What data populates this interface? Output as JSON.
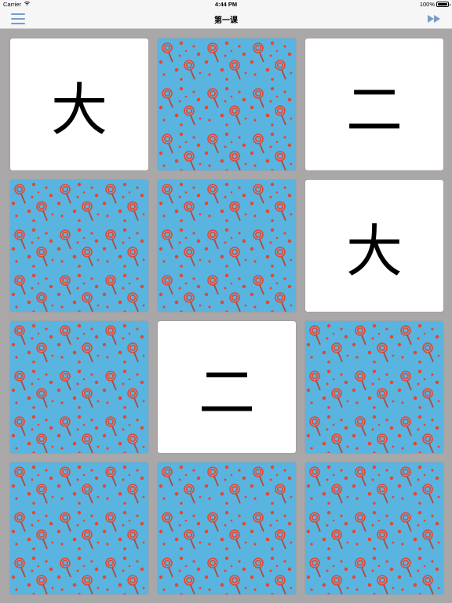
{
  "status_bar": {
    "carrier": "Carrier",
    "time": "4:44 PM",
    "battery_percent": "100%",
    "battery_level": 1.0
  },
  "nav": {
    "title": "第一课",
    "menu_icon": "hamburger-menu-icon",
    "forward_icon": "fast-forward-icon",
    "accent_color": "#7a9cc6"
  },
  "card_back": {
    "pattern": "lollipop-pattern",
    "background_color": "#5ab4e0",
    "dot_color": "#e8452d",
    "lollipop_color": "#e8452d",
    "stick_color": "#b04a3a"
  },
  "cards": [
    {
      "state": "face-up",
      "text": "大"
    },
    {
      "state": "face-down",
      "text": ""
    },
    {
      "state": "face-up",
      "text": "二"
    },
    {
      "state": "face-down",
      "text": ""
    },
    {
      "state": "face-down",
      "text": ""
    },
    {
      "state": "face-up",
      "text": "大"
    },
    {
      "state": "face-down",
      "text": ""
    },
    {
      "state": "face-up",
      "text": "二"
    },
    {
      "state": "face-down",
      "text": ""
    },
    {
      "state": "face-down",
      "text": ""
    },
    {
      "state": "face-down",
      "text": ""
    },
    {
      "state": "face-down",
      "text": ""
    }
  ]
}
